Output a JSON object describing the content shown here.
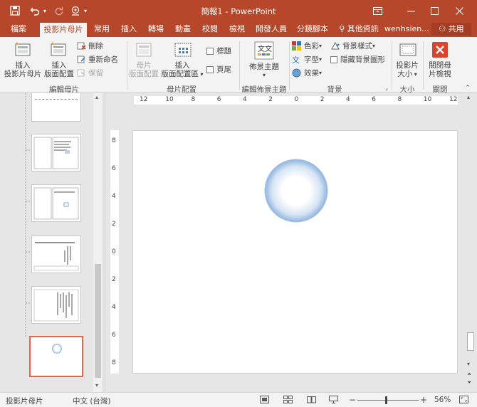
{
  "titlebar": {
    "title": "簡報1 - PowerPoint",
    "save_icon": "save-icon",
    "undo_icon": "undo-icon",
    "redo_icon": "redo-icon",
    "customize_icon": "touch-mode-icon",
    "window_icons": [
      "ribbon-display-icon",
      "minimize-icon",
      "maximize-icon",
      "close-icon"
    ]
  },
  "tabs": {
    "file": "檔案",
    "slide_master": "投影片母片",
    "home": "常用",
    "insert": "插入",
    "transitions": "轉場",
    "animations": "動畫",
    "review": "校閱",
    "view": "檢視",
    "developer": "開發人員",
    "storyboard": "分鏡腳本",
    "tell_me": "其他資訊",
    "user": "wenhsien...",
    "share": "共用"
  },
  "ribbon": {
    "edit_master": {
      "group": "編輯母片",
      "insert_master_l1": "插入",
      "insert_master_l2": "投影片母片",
      "insert_layout_l1": "插入",
      "insert_layout_l2": "版面配置",
      "delete": "刪除",
      "rename": "重新命名",
      "preserve": "保留"
    },
    "master_layout": {
      "group": "母片配置",
      "master_layout_l1": "母片",
      "master_layout_l2": "版面配置",
      "insert_placeholder_l1": "插入",
      "insert_placeholder_l2": "版面配置區",
      "title": "標題",
      "footers": "頁尾"
    },
    "edit_theme": {
      "group": "編輯佈景主題",
      "themes": "佈景主題"
    },
    "background": {
      "group": "背景",
      "colors": "色彩",
      "fonts": "字型",
      "effects": "效果",
      "bg_styles": "背景樣式",
      "hide_bg": "隱藏背景圖形"
    },
    "size": {
      "group": "大小",
      "slide_size_l1": "投影片",
      "slide_size_l2": "大小"
    },
    "close": {
      "group": "關閉",
      "close_l1": "關閉母",
      "close_l2": "片檢視"
    }
  },
  "thumbnail_count": 6,
  "ruler": {
    "h_labels": [
      "12",
      "10",
      "8",
      "6",
      "4",
      "2",
      "0",
      "2",
      "4",
      "6",
      "8",
      "10",
      "12"
    ],
    "v_labels": [
      "8",
      "6",
      "4",
      "2",
      "0",
      "2",
      "4",
      "6",
      "8"
    ]
  },
  "statusbar": {
    "view_name": "投影片母片",
    "language": "中文 (台灣)",
    "zoom": "56%",
    "zoom_fraction": 0.45,
    "minus": "−",
    "plus": "+"
  },
  "colors": {
    "accent": "#b7472a",
    "selection": "#e0684b",
    "ribbon_bg": "#f3f3f3"
  }
}
